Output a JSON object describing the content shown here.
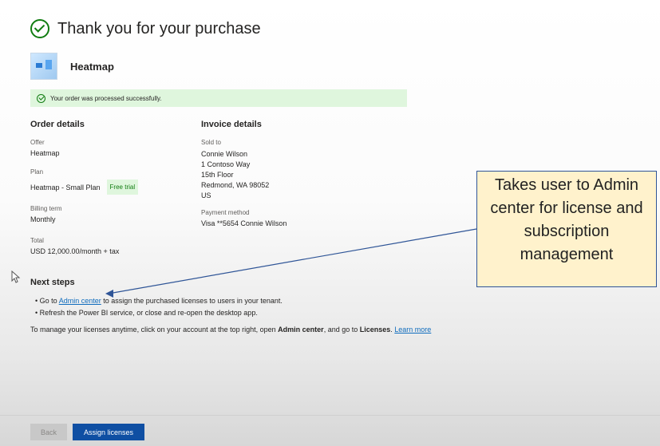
{
  "page": {
    "title": "Thank you for your purchase",
    "product_name": "Heatmap",
    "success_message": "Your order was processed successfully."
  },
  "order_details": {
    "section_title": "Order details",
    "offer_label": "Offer",
    "offer_value": "Heatmap",
    "plan_label": "Plan",
    "plan_value": "Heatmap - Small Plan",
    "plan_badge": "Free trial",
    "billing_label": "Billing term",
    "billing_value": "Monthly",
    "total_label": "Total",
    "total_value": "USD 12,000.00/month + tax"
  },
  "invoice_details": {
    "section_title": "Invoice details",
    "sold_to_label": "Sold to",
    "sold_to_lines": [
      "Connie Wilson",
      "1 Contoso Way",
      "15th Floor",
      "Redmond, WA 98052",
      "US"
    ],
    "payment_label": "Payment method",
    "payment_value": "Visa **5654 Connie Wilson"
  },
  "next_steps": {
    "title": "Next steps",
    "step1_before": "Go to ",
    "step1_link": "Admin center",
    "step1_after": " to assign the purchased licenses to users in your tenant.",
    "step2": "Refresh the Power BI service, or close and re-open the desktop app.",
    "manage_text": "To manage your licenses anytime, click on your account at the top right, open ",
    "manage_admin": "Admin center",
    "manage_mid": ", and go to ",
    "manage_licenses": "Licenses",
    "manage_end": ". ",
    "learn_more": "Learn more"
  },
  "annotation": {
    "note_text": "Takes user to Admin center for license and subscription management",
    "border_color": "#2f5597",
    "fill_color": "#fff2cc"
  },
  "footer": {
    "back_label": "Back",
    "assign_label": "Assign licenses"
  },
  "colors": {
    "success_green": "#107c10",
    "success_bg": "#dff6dd",
    "link_blue": "#0f6cbd",
    "primary_button": "#0f4fa3"
  }
}
